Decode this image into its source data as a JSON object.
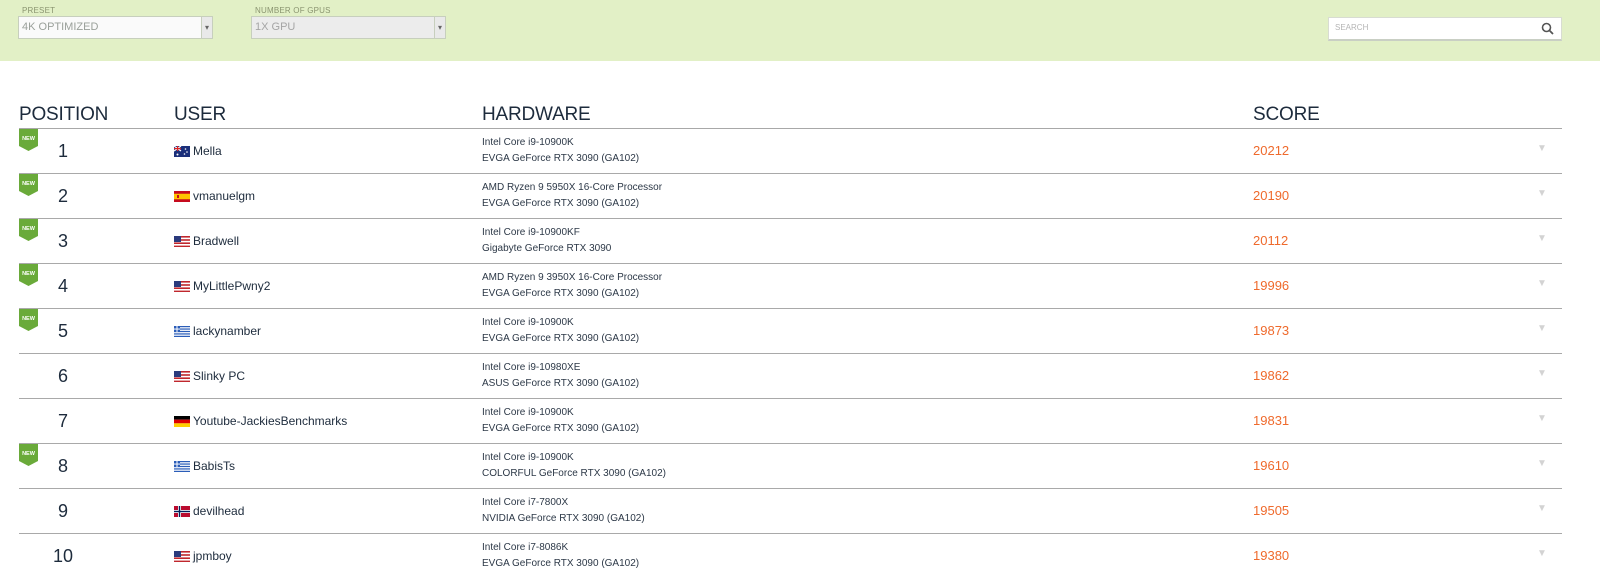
{
  "filters": {
    "preset_label": "PRESET",
    "preset_value": "4K OPTIMIZED",
    "gpus_label": "NUMBER OF GPUs",
    "gpus_value": "1X GPU",
    "search_placeholder": "SEARCH"
  },
  "table": {
    "headers": {
      "position": "POSITION",
      "user": "USER",
      "hardware": "HARDWARE",
      "score": "SCORE"
    },
    "new_badge_text": "NEW",
    "rows": [
      {
        "position": "1",
        "new": true,
        "flag": "australia-flag-icon",
        "user": "Mella",
        "cpu": "Intel Core i9-10900K",
        "gpu": "EVGA GeForce RTX 3090 (GA102)",
        "score": "20212"
      },
      {
        "position": "2",
        "new": true,
        "flag": "spain-flag-icon",
        "user": "vmanuelgm",
        "cpu": "AMD Ryzen 9 5950X 16-Core Processor",
        "gpu": "EVGA GeForce RTX 3090 (GA102)",
        "score": "20190"
      },
      {
        "position": "3",
        "new": true,
        "flag": "usa-flag-icon",
        "user": "Bradwell",
        "cpu": "Intel Core i9-10900KF",
        "gpu": "Gigabyte GeForce RTX 3090",
        "score": "20112"
      },
      {
        "position": "4",
        "new": true,
        "flag": "usa-flag-icon",
        "user": "MyLittlePwny2",
        "cpu": "AMD Ryzen 9 3950X 16-Core Processor",
        "gpu": "EVGA GeForce RTX 3090 (GA102)",
        "score": "19996"
      },
      {
        "position": "5",
        "new": true,
        "flag": "greece-flag-icon",
        "user": "lackynamber",
        "cpu": "Intel Core i9-10900K",
        "gpu": "EVGA GeForce RTX 3090 (GA102)",
        "score": "19873"
      },
      {
        "position": "6",
        "new": false,
        "flag": "usa-flag-icon",
        "user": "Slinky PC",
        "cpu": "Intel Core i9-10980XE",
        "gpu": "ASUS GeForce RTX 3090 (GA102)",
        "score": "19862"
      },
      {
        "position": "7",
        "new": false,
        "flag": "germany-flag-icon",
        "user": "Youtube-JackiesBenchmarks",
        "cpu": "Intel Core i9-10900K",
        "gpu": "EVGA GeForce RTX 3090 (GA102)",
        "score": "19831"
      },
      {
        "position": "8",
        "new": true,
        "flag": "greece-flag-icon",
        "user": "BabisTs",
        "cpu": "Intel Core i9-10900K",
        "gpu": "COLORFUL GeForce RTX 3090 (GA102)",
        "score": "19610"
      },
      {
        "position": "9",
        "new": false,
        "flag": "norway-flag-icon",
        "user": "devilhead",
        "cpu": "Intel Core i7-7800X",
        "gpu": "NVIDIA GeForce RTX 3090 (GA102)",
        "score": "19505"
      },
      {
        "position": "10",
        "new": false,
        "flag": "usa-flag-icon",
        "user": "jpmboy",
        "cpu": "Intel Core i7-8086K",
        "gpu": "EVGA GeForce RTX 3090 (GA102)",
        "score": "19380"
      }
    ]
  },
  "colors": {
    "filter_bar": "#e2f0c6",
    "new_badge": "#6aaa3a",
    "score": "#ef6a2c",
    "heading": "#1d2b3c"
  }
}
